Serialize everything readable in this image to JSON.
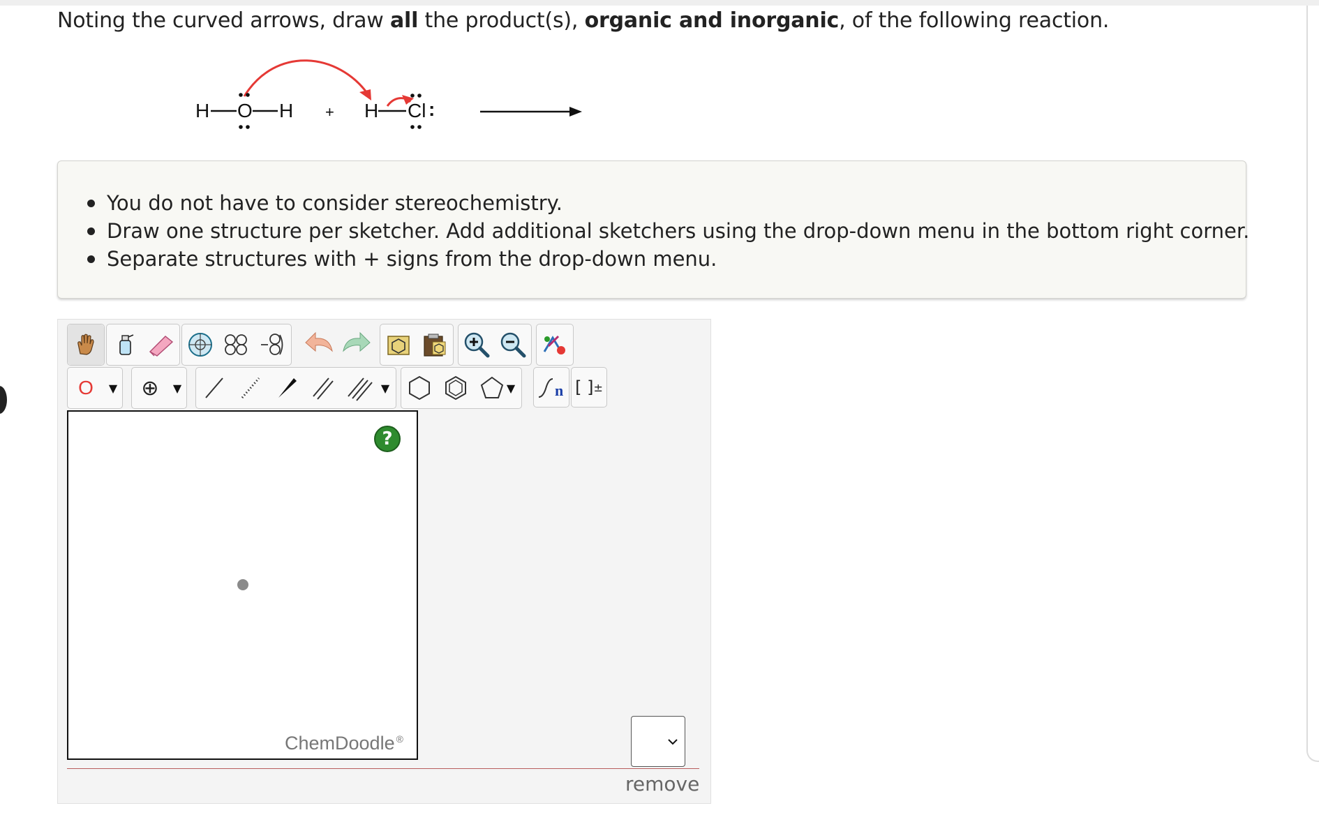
{
  "question": {
    "p1": "Noting the curved arrows, draw ",
    "b1": "all",
    "p2": " the product(s), ",
    "b2": "organic and inorganic",
    "p3": ", of the following reaction."
  },
  "reaction": {
    "plus": "+",
    "h": "H",
    "o": "O",
    "cl": "Cl",
    "colon": ":",
    "arrow_color": "#e53935"
  },
  "instructions": [
    "You do not have to consider stereochemistry.",
    "Draw one structure per sketcher. Add additional sketchers using the drop-down menu in the bottom right corner.",
    "Separate structures with + signs from the drop-down menu."
  ],
  "toolbar_row1": [
    "hand-pan-icon",
    "clear-bottle-icon",
    "eraser-icon",
    "center-icon",
    "flip-horizontal-icon",
    "flip-vertical-icon",
    "undo-icon",
    "redo-icon",
    "template-icon",
    "clipboard-icon",
    "zoom-in-icon",
    "zoom-out-icon",
    "clean-structure-icon"
  ],
  "toolbar_row2": {
    "atom_label": "O",
    "charge_symbol": "⊕",
    "bracket_label": "[ ]",
    "bracket_charge": "±",
    "repeat_label": "n"
  },
  "sketcher": {
    "help": "?",
    "logo": "ChemDoodle",
    "logo_reg": "®"
  },
  "remove_label": "remove",
  "accent_colors": {
    "atom_o": "#e53935",
    "help_green": "#2e8b2e",
    "red_line": "#b85c5c"
  }
}
